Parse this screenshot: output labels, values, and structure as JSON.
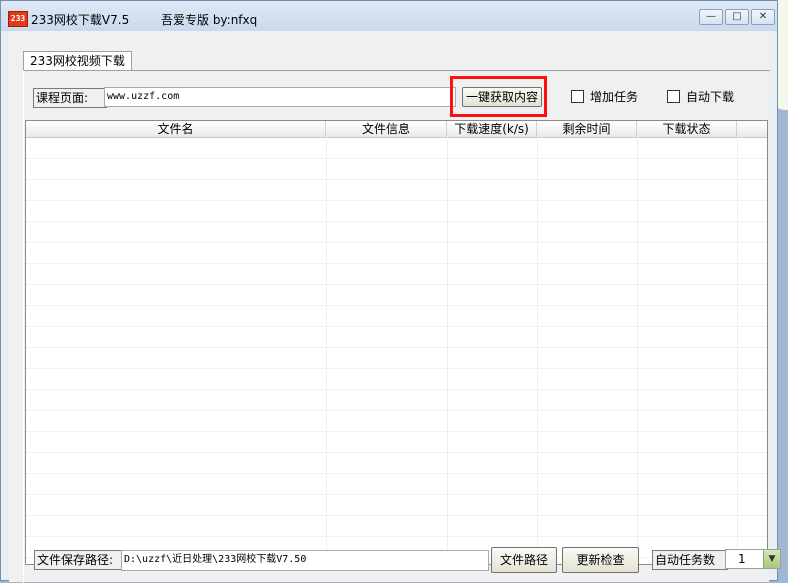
{
  "window": {
    "title": "233网校下载V7.5",
    "edition": "吾爱专版  by:nfxq",
    "app_icon_text": "233",
    "controls": {
      "minimize": "—",
      "maximize": "□",
      "close": "✕"
    }
  },
  "tabs": [
    {
      "label": "233网校视频下载",
      "active": true
    }
  ],
  "course": {
    "label": "课程页面:",
    "url": "www.uzzf.com",
    "fetch_button": "一键获取内容"
  },
  "options": {
    "add_task": {
      "label": "增加任务",
      "checked": false
    },
    "auto_download": {
      "label": "自动下载",
      "checked": false
    }
  },
  "table": {
    "columns": [
      "文件名",
      "文件信息",
      "下载速度(k/s)",
      "剩余时间",
      "下载状态"
    ],
    "rows": []
  },
  "footer": {
    "save_path_label": "文件保存路径:",
    "save_path_value": "D:\\uzzf\\近日处理\\233网校下载V7.50",
    "file_path_button": "文件路径",
    "update_button": "更新检查",
    "auto_tasks_label": "自动任务数",
    "auto_tasks_value": "1"
  },
  "colors": {
    "highlight": "#ff1010"
  }
}
